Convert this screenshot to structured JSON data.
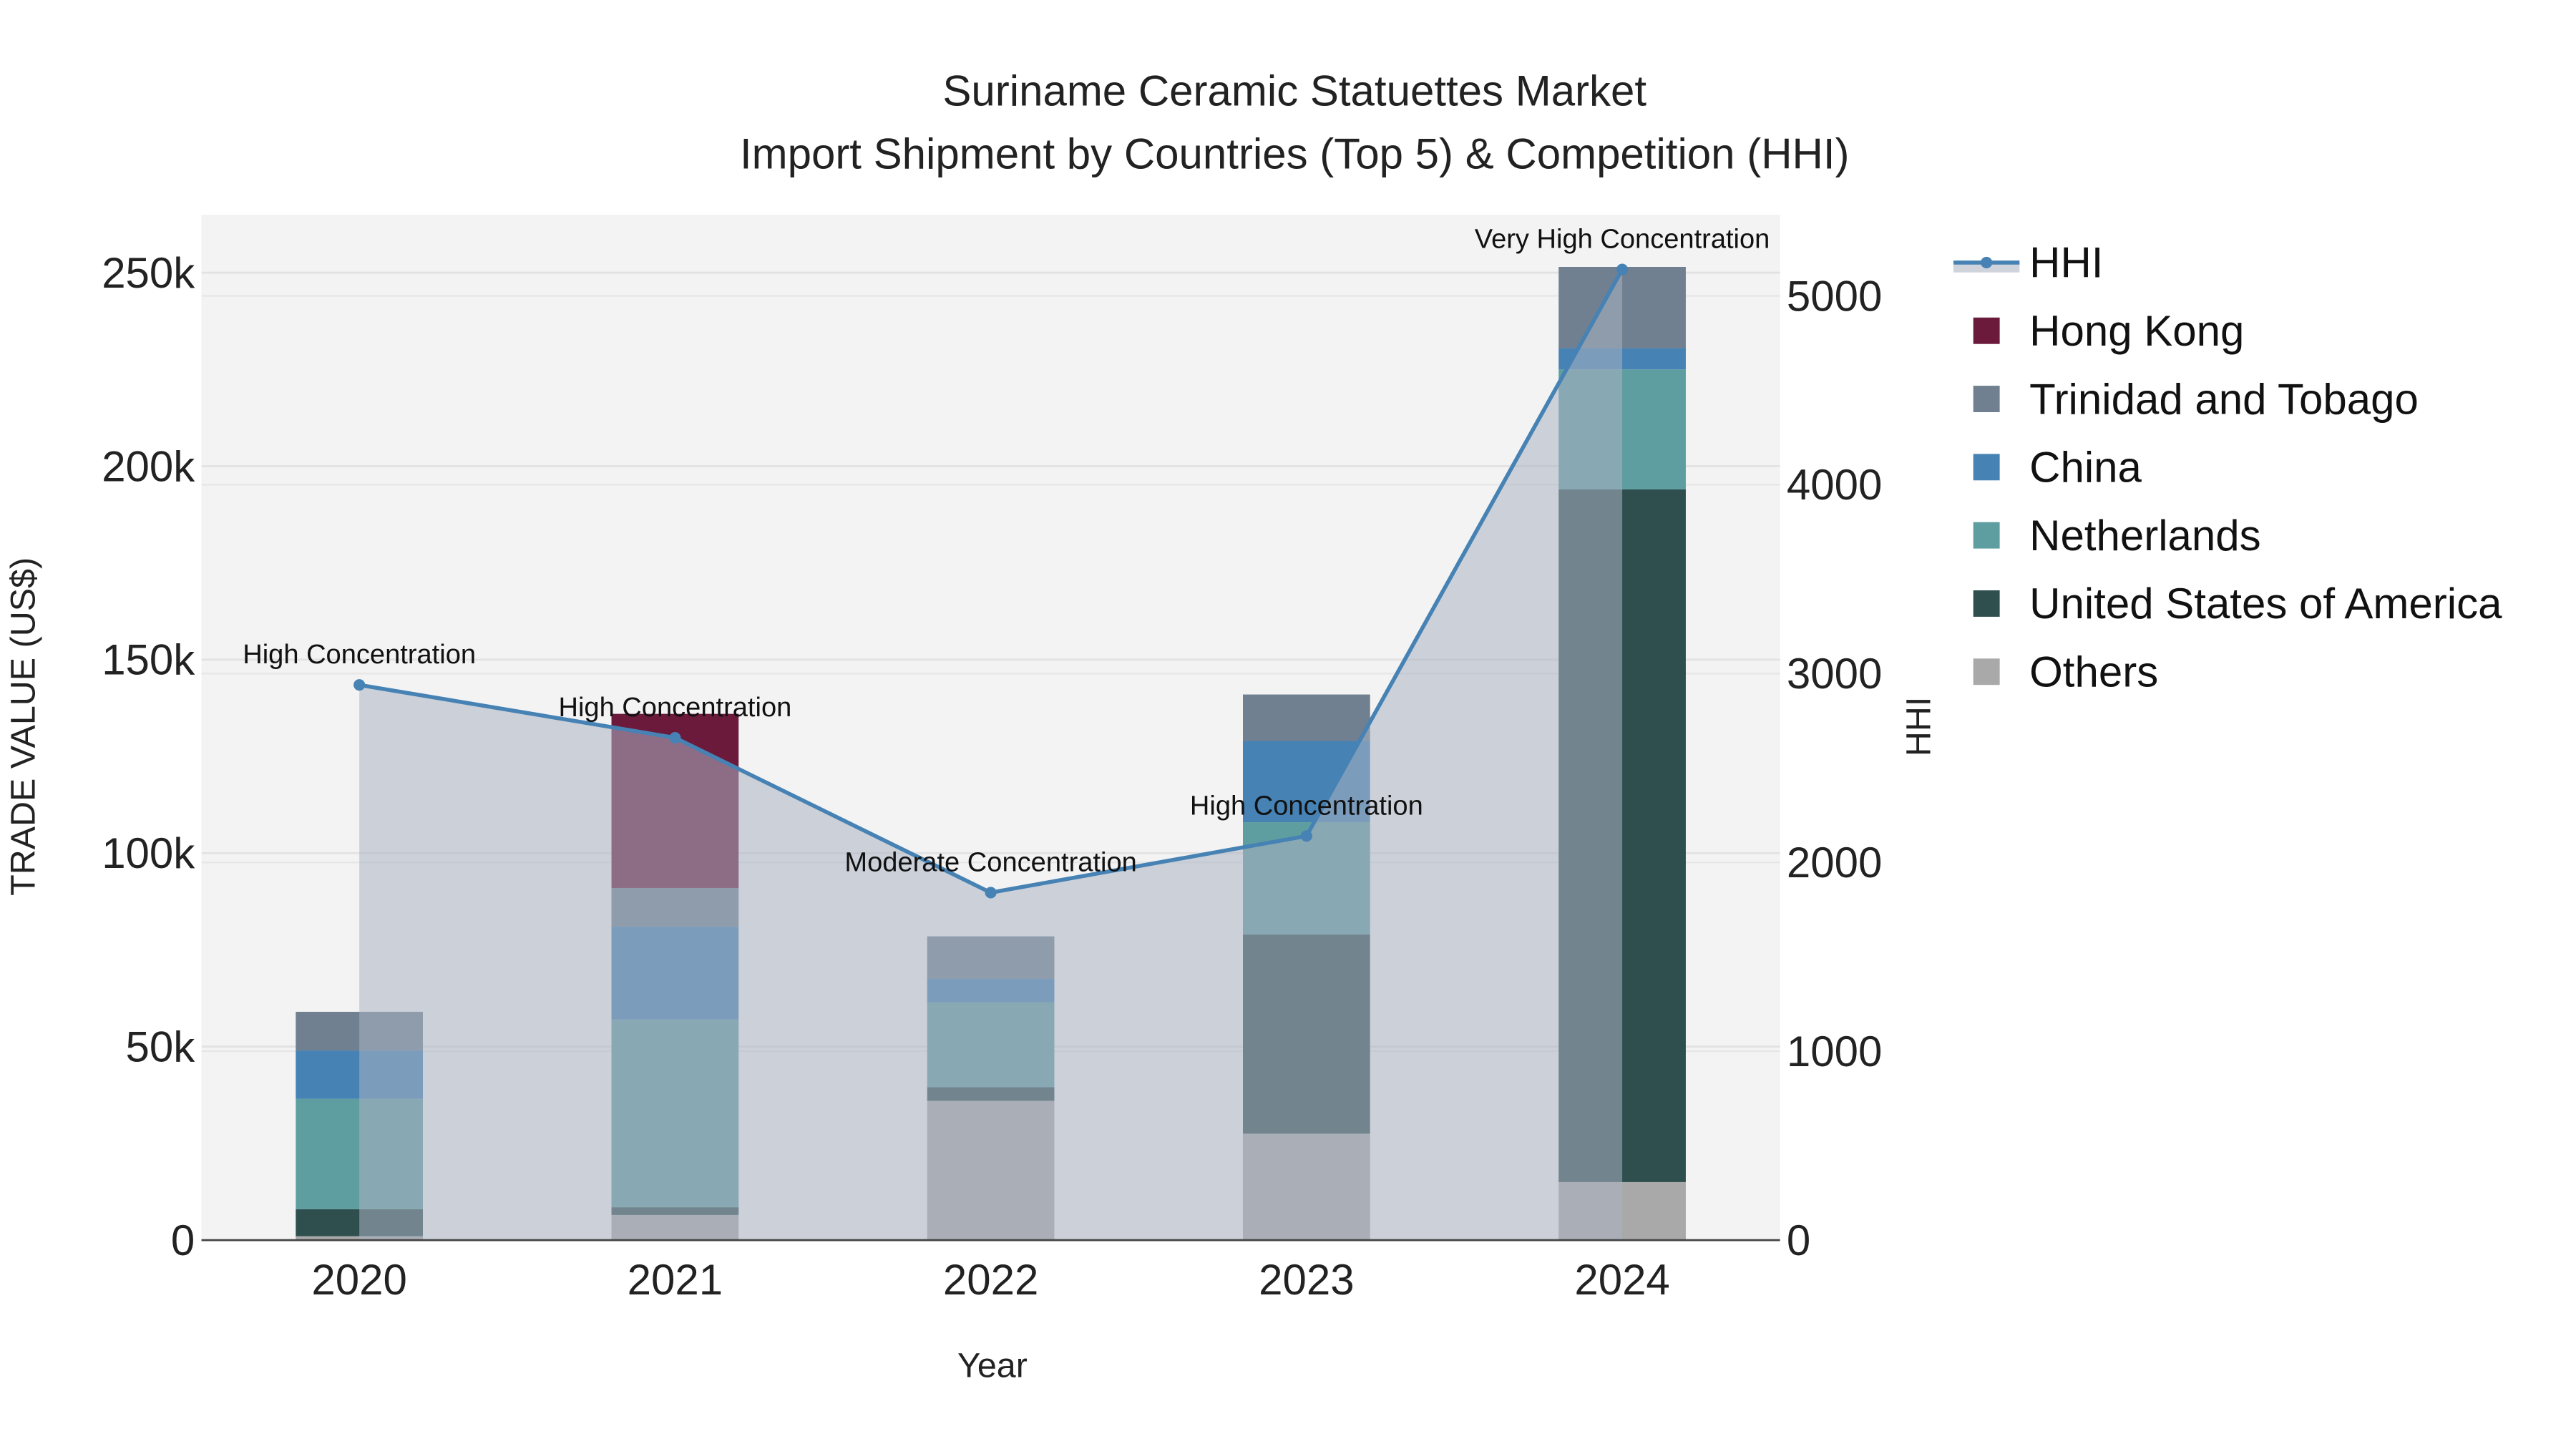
{
  "chart_data": {
    "type": "bar",
    "stacked": true,
    "title": "Suriname Ceramic Statuettes Market",
    "subtitle": "Import Shipment by Countries (Top 5) & Competition (HHI)",
    "xlabel": "Year",
    "ylabel": "TRADE VALUE (US$)",
    "y2label": "HHI",
    "categories": [
      "2020",
      "2021",
      "2022",
      "2023",
      "2024"
    ],
    "ylim": [
      0,
      265000
    ],
    "y2lim": [
      0,
      5430
    ],
    "yticks": [
      0,
      50000,
      100000,
      150000,
      200000,
      250000
    ],
    "ytick_labels": [
      "0",
      "50k",
      "100k",
      "150k",
      "200k",
      "250k"
    ],
    "y2ticks": [
      0,
      1000,
      2000,
      3000,
      4000,
      5000
    ],
    "y2tick_labels": [
      "0",
      "1000",
      "2000",
      "3000",
      "4000",
      "5000"
    ],
    "grid": true,
    "legend_position": "right",
    "series": [
      {
        "name": "Others",
        "color": "#a9a9a9",
        "values": [
          1000,
          6500,
          36000,
          27500,
          15000
        ]
      },
      {
        "name": "United States of America",
        "color": "#2f4f4f",
        "values": [
          7000,
          2000,
          3500,
          51500,
          179000
        ]
      },
      {
        "name": "Netherlands",
        "color": "#5f9ea0",
        "values": [
          28500,
          48500,
          22000,
          29000,
          31000
        ]
      },
      {
        "name": "China",
        "color": "#4682b4",
        "values": [
          12500,
          24000,
          6000,
          21000,
          5500
        ]
      },
      {
        "name": "Trinidad and Tobago",
        "color": "#708090",
        "values": [
          10000,
          10000,
          11000,
          12000,
          21000
        ]
      },
      {
        "name": "Hong Kong",
        "color": "#6b1a3c",
        "values": [
          0,
          45000,
          0,
          0,
          0
        ]
      }
    ],
    "line": {
      "name": "HHI",
      "color": "#4682b4",
      "axis": "right",
      "values": [
        2940,
        2660,
        1840,
        2140,
        5140
      ],
      "annotations": [
        "High Concentration",
        "High Concentration",
        "Moderate Concentration",
        "High Concentration",
        "Very High Concentration"
      ]
    },
    "legend": [
      "HHI",
      "Hong Kong",
      "Trinidad and Tobago",
      "China",
      "Netherlands",
      "United States of America",
      "Others"
    ]
  }
}
